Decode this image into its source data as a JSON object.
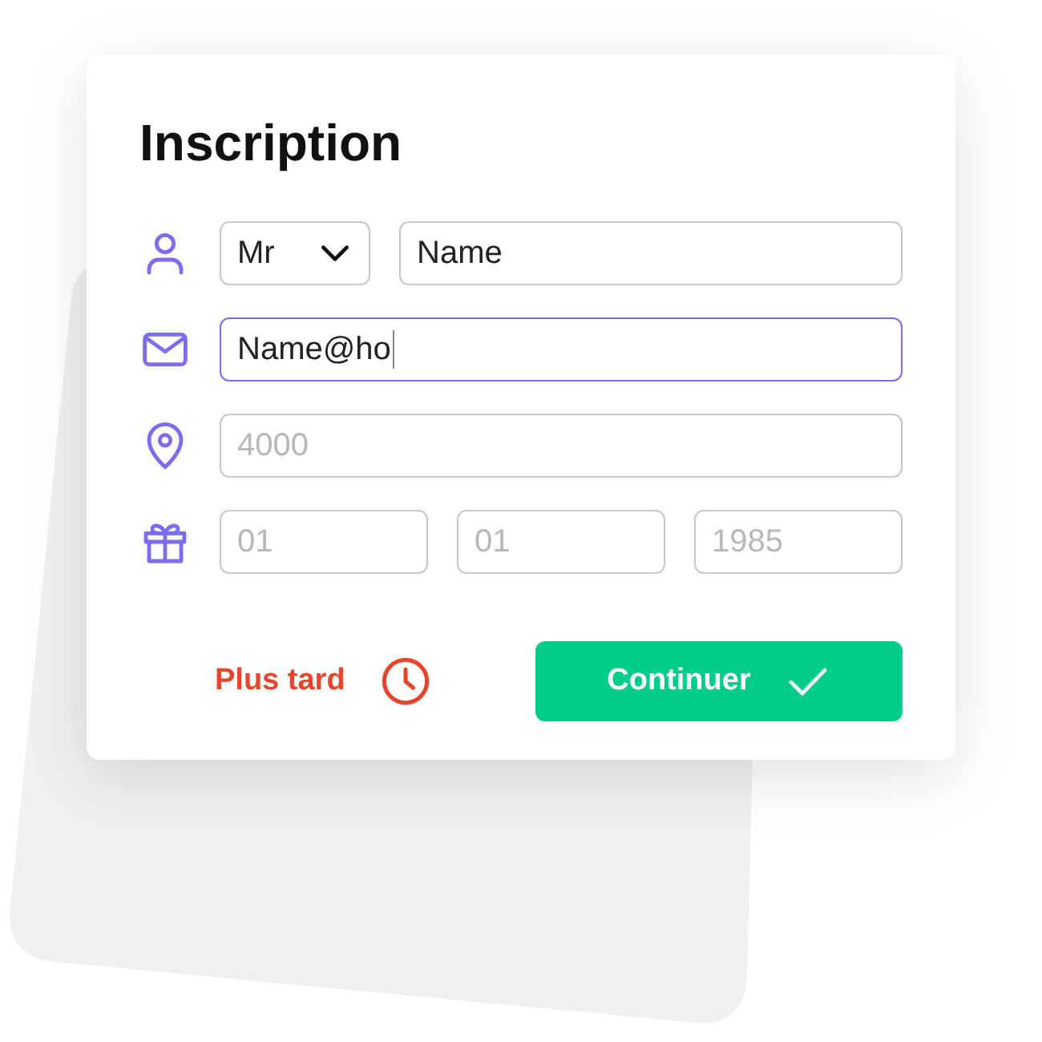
{
  "title": "Inscription",
  "rows": [
    {
      "kind": "person",
      "fields": [
        {
          "kind": "select",
          "value": "Mr"
        },
        {
          "kind": "text",
          "value": "Name",
          "focused": false
        }
      ]
    },
    {
      "kind": "mail",
      "fields": [
        {
          "kind": "text",
          "value": "Name@ho",
          "focused": true
        }
      ]
    },
    {
      "kind": "pin",
      "fields": [
        {
          "kind": "text",
          "placeholder": "4000",
          "focused": false
        }
      ]
    },
    {
      "kind": "gift",
      "fields": [
        {
          "kind": "text",
          "placeholder": "01",
          "focused": false
        },
        {
          "kind": "text",
          "placeholder": "01",
          "focused": false
        },
        {
          "kind": "text",
          "placeholder": "1985",
          "focused": false
        }
      ]
    }
  ],
  "later_button": {
    "label": "Plus tard"
  },
  "continue_button": {
    "label": "Continuer"
  }
}
